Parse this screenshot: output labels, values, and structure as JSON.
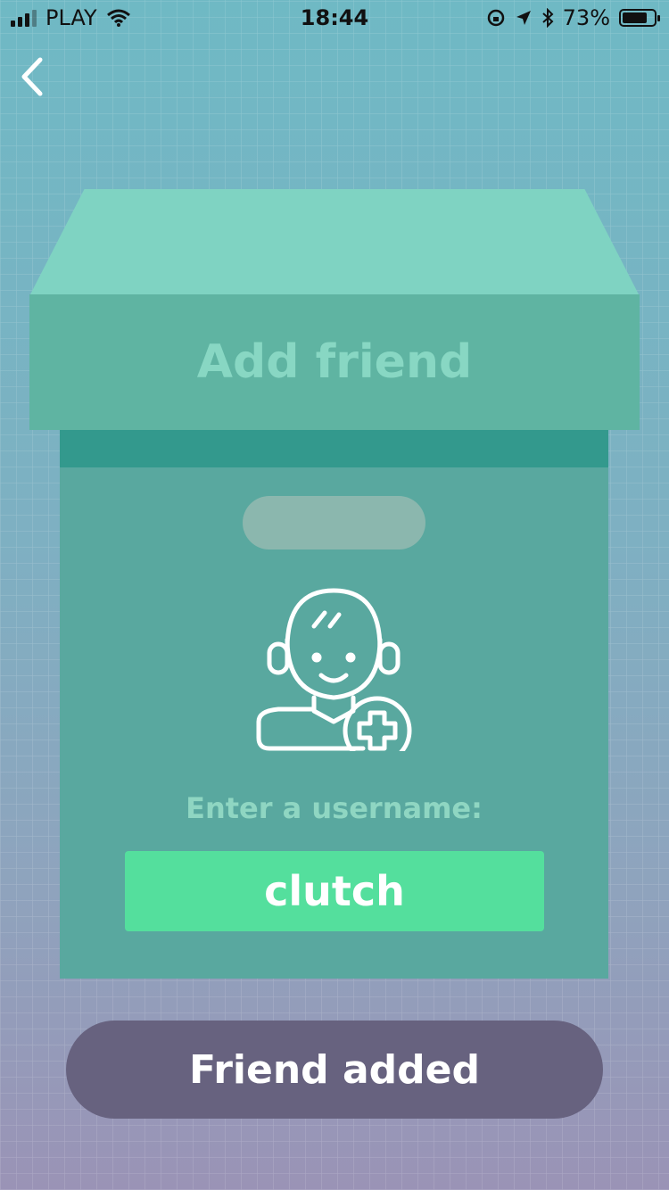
{
  "status_bar": {
    "carrier": "PLAY",
    "time": "18:44",
    "battery_percent": "73%",
    "icons": [
      "signal-icon",
      "wifi-icon",
      "rotation-lock-icon",
      "location-icon",
      "bluetooth-icon",
      "battery-icon"
    ]
  },
  "nav": {
    "back_icon": "chevron-left-icon"
  },
  "card": {
    "title": "Add friend",
    "avatar_icon": "user-add-icon",
    "prompt": "Enter a username:",
    "username_value": "clutch"
  },
  "action": {
    "label": "Friend added"
  },
  "colors": {
    "lid_top": "#7fd3c2",
    "lid_front": "#5fb4a2",
    "box_body": "#59a89f",
    "band": "#33998d",
    "input_bg": "#54df9d",
    "button_bg": "#67627f"
  }
}
